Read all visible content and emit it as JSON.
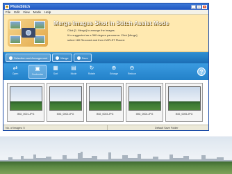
{
  "window": {
    "title": "PhotoStitch",
    "controls": [
      "_",
      "□",
      "×"
    ]
  },
  "menu": {
    "items": [
      "File",
      "Edit",
      "View",
      "Mode",
      "Help"
    ]
  },
  "header": {
    "mode_title": "Merge Images Shot in Stitch Assist Mode",
    "instructions": [
      "Click [1. Merge] to arrange the images.",
      "It is suggested as a 360 degree panorama. Click [Merge].",
      "select 180 Rezoned and then CAPLET Placed."
    ]
  },
  "tabs": [
    {
      "label": "Selection and Arrangement",
      "icon": "selection-icon"
    },
    {
      "label": "Merge",
      "icon": "merge-icon"
    },
    {
      "label": "Save",
      "icon": "save-icon"
    }
  ],
  "toolbar": {
    "tools": [
      {
        "label": "Open",
        "icon": "open-icon"
      },
      {
        "label": "Customize",
        "icon": "customize-icon"
      },
      {
        "label": "Sort",
        "icon": "sort-icon"
      },
      {
        "label": "Mode",
        "icon": "mode-icon"
      },
      {
        "label": "Rotate",
        "icon": "rotate-icon"
      },
      {
        "label": "Enlarge",
        "icon": "enlarge-icon"
      },
      {
        "label": "Reduce",
        "icon": "reduce-icon"
      }
    ],
    "help_label": "?"
  },
  "thumbnails": [
    {
      "caption": "IMG_0001.JPG"
    },
    {
      "caption": "IMG_0002.JPG"
    },
    {
      "caption": "IMG_0003.JPG"
    },
    {
      "caption": "IMG_0004.JPG"
    },
    {
      "caption": "IMG_0005.JPG"
    }
  ],
  "status": {
    "left": "No. of images: 5",
    "right": "Default Save Folder"
  },
  "colors": {
    "header_band": "#ffe9b0",
    "toolbar_blue": "#2381c9",
    "title_bar": "#1f56c2"
  }
}
